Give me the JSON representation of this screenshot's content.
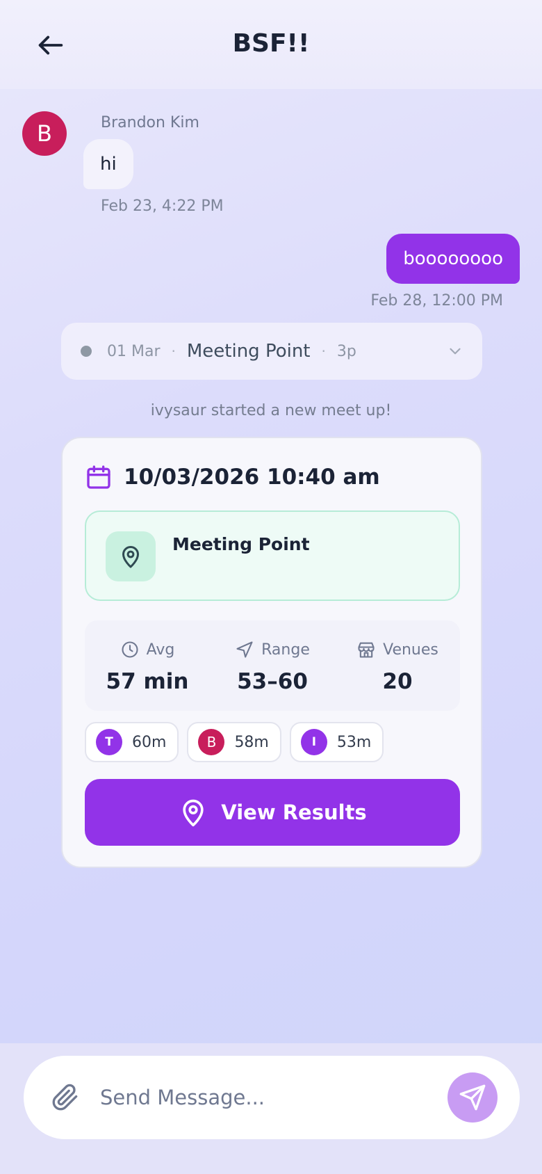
{
  "header": {
    "title": "BSF!!"
  },
  "messages": {
    "incoming": {
      "avatar_letter": "B",
      "sender": "Brandon Kim",
      "text": "hi",
      "time": "Feb 23, 4:22 PM"
    },
    "outgoing": {
      "text": "boooooooo",
      "time": "Feb 28, 12:00 PM"
    }
  },
  "meet_summary": {
    "date": "01 Mar",
    "separator": "·",
    "title": "Meeting Point",
    "time": "3p"
  },
  "system_message": "ivysaur started a new meet up!",
  "meetup_card": {
    "datetime": "10/03/2026 10:40 am",
    "location_title": "Meeting Point",
    "stats": [
      {
        "label": "Avg",
        "value": "57 min",
        "icon": "clock-icon"
      },
      {
        "label": "Range",
        "value": "53–60",
        "icon": "navigation-icon"
      },
      {
        "label": "Venues",
        "value": "20",
        "icon": "store-icon"
      }
    ],
    "participants": [
      {
        "initial": "T",
        "duration": "60m",
        "color": "#9233e8"
      },
      {
        "initial": "B",
        "duration": "58m",
        "color": "#c81e5b"
      },
      {
        "initial": "I",
        "duration": "53m",
        "color": "#9233e8"
      }
    ],
    "button_label": "View Results"
  },
  "composer": {
    "placeholder": "Send Message...",
    "value": ""
  },
  "colors": {
    "accent": "#9233e8",
    "avatar_b": "#c81e5b",
    "send_button": "#c89cf3"
  }
}
